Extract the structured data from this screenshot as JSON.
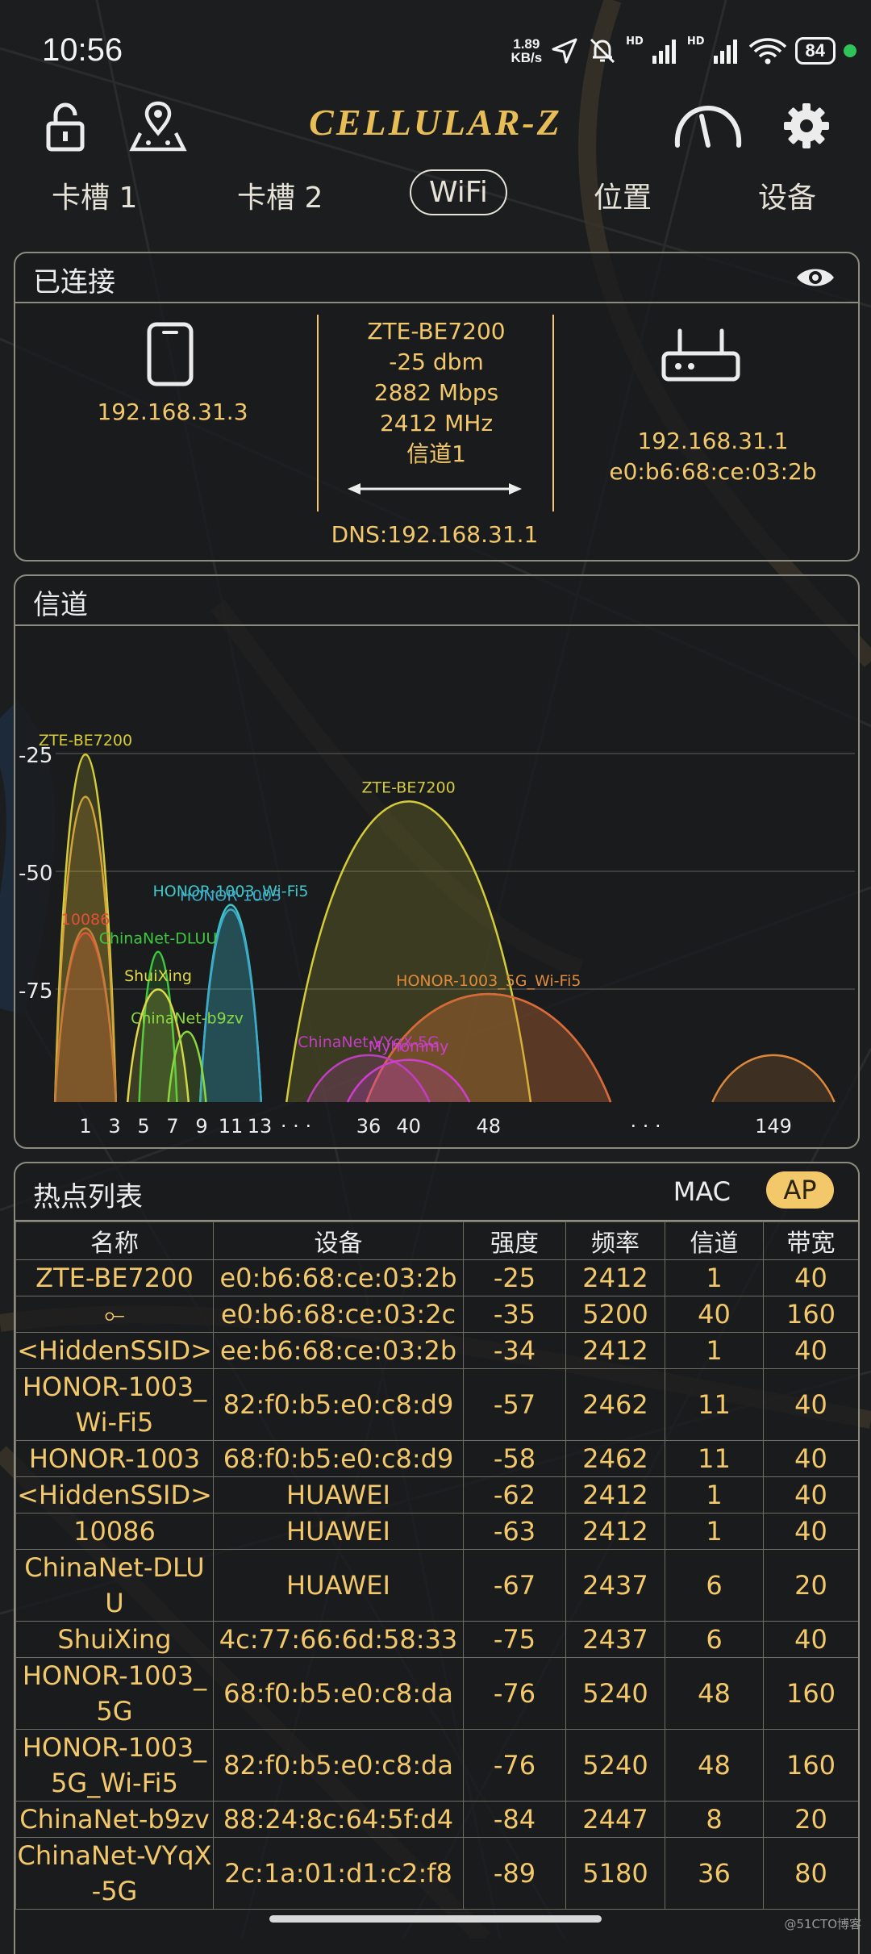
{
  "status_bar": {
    "time": "10:56",
    "net_speed_value": "1.89",
    "net_speed_unit": "KB/s",
    "signal1_tag": "HD",
    "signal2_tag": "HD",
    "battery": "84"
  },
  "header": {
    "title": "CELLULAR-Z"
  },
  "tabs": [
    {
      "label": "卡槽 1"
    },
    {
      "label": "卡槽 2"
    },
    {
      "label": "WiFi",
      "active": true
    },
    {
      "label": "位置"
    },
    {
      "label": "设备"
    }
  ],
  "connected": {
    "title": "已连接",
    "phone_ip": "192.168.31.3",
    "ssid": "ZTE-BE7200",
    "signal": "-25 dbm",
    "speed": "2882 Mbps",
    "frequency": "2412 MHz",
    "channel": "信道1",
    "router_ip": "192.168.31.1",
    "router_mac": "e0:b6:68:ce:03:2b",
    "dns": "DNS:192.168.31.1"
  },
  "channel_panel": {
    "title": "信道"
  },
  "chart_data": {
    "type": "area",
    "y_ticks": [
      {
        "label": "-25",
        "value": -25
      },
      {
        "label": "-50",
        "value": -50
      },
      {
        "label": "-75",
        "value": -75
      }
    ],
    "x_ticks": [
      {
        "label": "1",
        "value": 1
      },
      {
        "label": "3",
        "value": 3
      },
      {
        "label": "5",
        "value": 5
      },
      {
        "label": "7",
        "value": 7
      },
      {
        "label": "9",
        "value": 9
      },
      {
        "label": "11",
        "value": 11
      },
      {
        "label": "13",
        "value": 13
      },
      {
        "label": "· · ·",
        "value": 15.5
      },
      {
        "label": "36",
        "value": 36
      },
      {
        "label": "40",
        "value": 40
      },
      {
        "label": "48",
        "value": 48
      },
      {
        "label": "· · ·",
        "value": 137
      },
      {
        "label": "149",
        "value": 149
      }
    ],
    "series": [
      {
        "name": "ZTE-BE7200",
        "channel": 1,
        "width": 40,
        "dbm": -25,
        "color": "#d4cc3a",
        "labeled": true
      },
      {
        "name": "",
        "channel": 1,
        "width": 40,
        "dbm": -34,
        "color": "#d4a33a",
        "labeled": false
      },
      {
        "name": "10086",
        "channel": 1,
        "width": 40,
        "dbm": -63,
        "color": "#e0503a",
        "labeled": true
      },
      {
        "name": "",
        "channel": 1,
        "width": 40,
        "dbm": -62,
        "color": "#c0803a",
        "labeled": false
      },
      {
        "name": "HONOR-1003_Wi-Fi5",
        "channel": 11,
        "width": 40,
        "dbm": -57,
        "color": "#3ec8c8",
        "labeled": true
      },
      {
        "name": "HONOR-1003",
        "channel": 11,
        "width": 40,
        "dbm": -58,
        "color": "#3ea8c8",
        "labeled": true
      },
      {
        "name": "ChinaNet-DLUU",
        "channel": 6,
        "width": 20,
        "dbm": -67,
        "color": "#3ec83e",
        "labeled": true
      },
      {
        "name": "ShuiXing",
        "channel": 6,
        "width": 40,
        "dbm": -75,
        "color": "#e0d84a",
        "labeled": true
      },
      {
        "name": "ChinaNet-b9zv",
        "channel": 8,
        "width": 20,
        "dbm": -84,
        "color": "#8ad83e",
        "labeled": true
      },
      {
        "name": "ZTE-BE7200",
        "channel": 40,
        "width": 160,
        "dbm": -35,
        "color": "#d4cc3a",
        "labeled": true
      },
      {
        "name": "HONOR-1003_5G_Wi-Fi5",
        "channel": 48,
        "width": 160,
        "dbm": -76,
        "color": "#e08a3a",
        "labeled": true
      },
      {
        "name": "",
        "channel": 48,
        "width": 160,
        "dbm": -76,
        "color": "#d86a3a",
        "labeled": false
      },
      {
        "name": "ChinaNet-VYqX-5G",
        "channel": 36,
        "width": 80,
        "dbm": -89,
        "color": "#c03ec0",
        "labeled": true
      },
      {
        "name": "Myhommy",
        "channel": 40,
        "width": 80,
        "dbm": -90,
        "color": "#d03ed0",
        "labeled": true
      },
      {
        "name": "",
        "channel": 149,
        "width": 80,
        "dbm": -89,
        "color": "#e0883a",
        "labeled": false
      }
    ]
  },
  "hotspots": {
    "title": "热点列表",
    "mac_label": "MAC",
    "ap_label": "AP",
    "columns": [
      "名称",
      "设备",
      "强度",
      "频率",
      "信道",
      "带宽"
    ],
    "rows": [
      {
        "name": "ZTE-BE7200",
        "device": "e0:b6:68:ce:03:2b",
        "strength": "-25",
        "freq": "2412",
        "channel": "1",
        "width": "40"
      },
      {
        "name": "⟜",
        "device": "e0:b6:68:ce:03:2c",
        "strength": "-35",
        "freq": "5200",
        "channel": "40",
        "width": "160"
      },
      {
        "name": "<HiddenSSID>",
        "device": "ee:b6:68:ce:03:2b",
        "strength": "-34",
        "freq": "2412",
        "channel": "1",
        "width": "40"
      },
      {
        "name": "HONOR-1003_\nWi-Fi5",
        "device": "82:f0:b5:e0:c8:d9",
        "strength": "-57",
        "freq": "2462",
        "channel": "11",
        "width": "40"
      },
      {
        "name": "HONOR-1003",
        "device": "68:f0:b5:e0:c8:d9",
        "strength": "-58",
        "freq": "2462",
        "channel": "11",
        "width": "40"
      },
      {
        "name": "<HiddenSSID>",
        "device": "HUAWEI",
        "strength": "-62",
        "freq": "2412",
        "channel": "1",
        "width": "40"
      },
      {
        "name": "10086",
        "device": "HUAWEI",
        "strength": "-63",
        "freq": "2412",
        "channel": "1",
        "width": "40"
      },
      {
        "name": "ChinaNet-DLU\nU",
        "device": "HUAWEI",
        "strength": "-67",
        "freq": "2437",
        "channel": "6",
        "width": "20"
      },
      {
        "name": "ShuiXing",
        "device": "4c:77:66:6d:58:33",
        "strength": "-75",
        "freq": "2437",
        "channel": "6",
        "width": "40"
      },
      {
        "name": "HONOR-1003_\n5G",
        "device": "68:f0:b5:e0:c8:da",
        "strength": "-76",
        "freq": "5240",
        "channel": "48",
        "width": "160"
      },
      {
        "name": "HONOR-1003_\n5G_Wi-Fi5",
        "device": "82:f0:b5:e0:c8:da",
        "strength": "-76",
        "freq": "5240",
        "channel": "48",
        "width": "160"
      },
      {
        "name": "ChinaNet-b9zv",
        "device": "88:24:8c:64:5f:d4",
        "strength": "-84",
        "freq": "2447",
        "channel": "8",
        "width": "20"
      },
      {
        "name": "ChinaNet-VYqX\n-5G",
        "device": "2c:1a:01:d1:c2:f8",
        "strength": "-89",
        "freq": "5180",
        "channel": "36",
        "width": "80"
      }
    ]
  },
  "watermark": "@51CTO博客"
}
